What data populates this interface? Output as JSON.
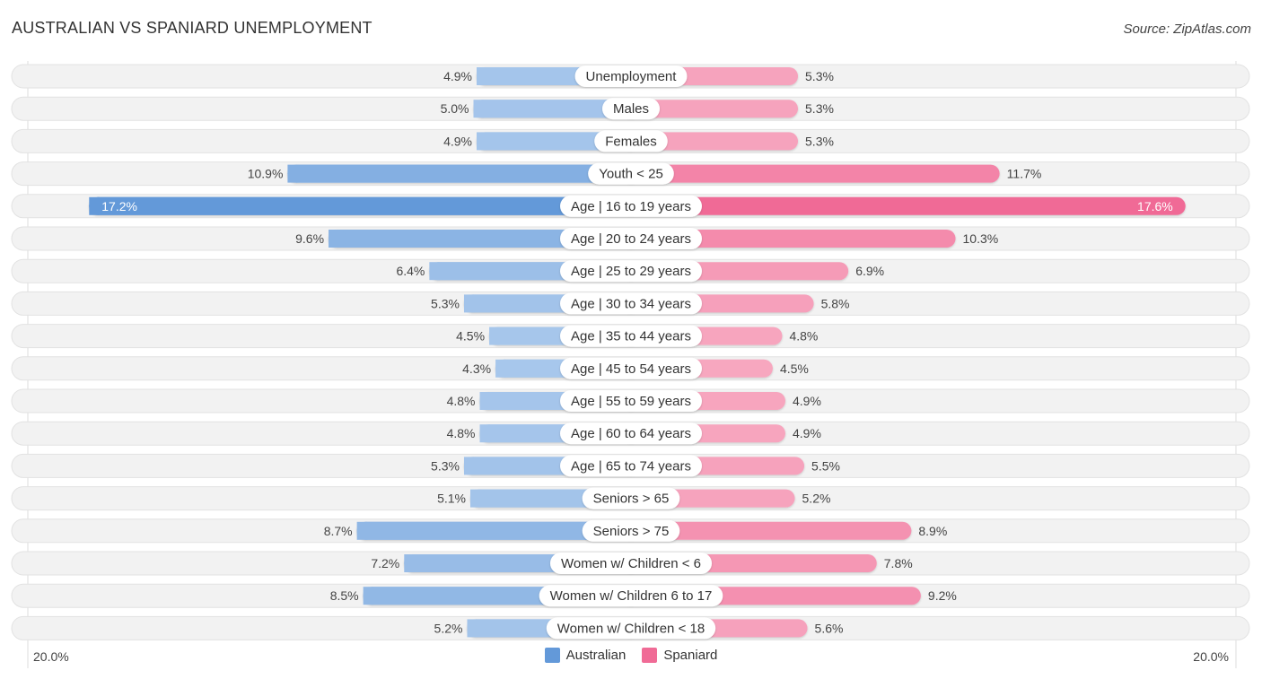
{
  "header": {
    "title": "AUSTRALIAN VS SPANIARD UNEMPLOYMENT",
    "source": "Source: ZipAtlas.com"
  },
  "colors": {
    "australian_strong": "#6399d9",
    "australian_light": "#a9c8ec",
    "spaniard_strong": "#f06b96",
    "spaniard_light": "#f7a9c1",
    "row_bg": "#f2f2f2"
  },
  "chart_data": {
    "type": "bar",
    "orientation": "horizontal-diverging",
    "title": "AUSTRALIAN VS SPANIARD UNEMPLOYMENT",
    "xlabel": "",
    "ylabel": "",
    "unit": "%",
    "xlim": [
      -20.0,
      20.0
    ],
    "axis_tick_labels": {
      "left": "20.0%",
      "right": "20.0%"
    },
    "legend_position": "bottom-center",
    "categories": [
      "Unemployment",
      "Males",
      "Females",
      "Youth < 25",
      "Age | 16 to 19 years",
      "Age | 20 to 24 years",
      "Age | 25 to 29 years",
      "Age | 30 to 34 years",
      "Age | 35 to 44 years",
      "Age | 45 to 54 years",
      "Age | 55 to 59 years",
      "Age | 60 to 64 years",
      "Age | 65 to 74 years",
      "Seniors > 65",
      "Seniors > 75",
      "Women w/ Children < 6",
      "Women w/ Children 6 to 17",
      "Women w/ Children < 18"
    ],
    "series": [
      {
        "name": "Australian",
        "side": "left",
        "values": [
          4.9,
          5.0,
          4.9,
          10.9,
          17.2,
          9.6,
          6.4,
          5.3,
          4.5,
          4.3,
          4.8,
          4.8,
          5.3,
          5.1,
          8.7,
          7.2,
          8.5,
          5.2
        ],
        "labels": [
          "4.9%",
          "5.0%",
          "4.9%",
          "10.9%",
          "17.2%",
          "9.6%",
          "6.4%",
          "5.3%",
          "4.5%",
          "4.3%",
          "4.8%",
          "4.8%",
          "5.3%",
          "5.1%",
          "8.7%",
          "7.2%",
          "8.5%",
          "5.2%"
        ]
      },
      {
        "name": "Spaniard",
        "side": "right",
        "values": [
          5.3,
          5.3,
          5.3,
          11.7,
          17.6,
          10.3,
          6.9,
          5.8,
          4.8,
          4.5,
          4.9,
          4.9,
          5.5,
          5.2,
          8.9,
          7.8,
          9.2,
          5.6
        ],
        "labels": [
          "5.3%",
          "5.3%",
          "5.3%",
          "11.7%",
          "17.6%",
          "10.3%",
          "6.9%",
          "5.8%",
          "4.8%",
          "4.5%",
          "4.9%",
          "4.9%",
          "5.5%",
          "5.2%",
          "8.9%",
          "7.8%",
          "9.2%",
          "5.6%"
        ]
      }
    ]
  },
  "legend": {
    "items": [
      {
        "label": "Australian",
        "color": "#6399d9"
      },
      {
        "label": "Spaniard",
        "color": "#f06b96"
      }
    ]
  }
}
